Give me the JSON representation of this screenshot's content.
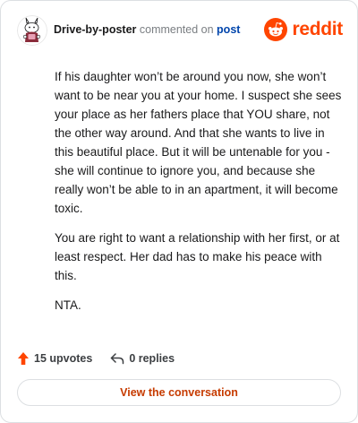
{
  "header": {
    "author": "Drive-by-poster",
    "action_text": "commented on",
    "target_link": "post",
    "brand_name": "reddit",
    "avatar_icon": "snoo-avatar-icon",
    "brand_icon": "reddit-snoo-icon"
  },
  "comment": {
    "paragraphs": [
      "If his daughter won’t be around you now, she won’t want to be near you at your home. I suspect she sees your place as her fathers place that YOU share, not the other way around. And that she wants to live in this beautiful place. But it will be untenable for you - she will continue to ignore you, and because she really won’t be able to in an apartment, it will become toxic.",
      "You are right to want a relationship with her first, or at least respect. Her dad has to make his peace with this.",
      "NTA."
    ]
  },
  "actions": {
    "upvotes": "15 upvotes",
    "replies": "0 replies",
    "upvote_icon": "upvote-arrow-icon",
    "reply_icon": "reply-arrow-icon"
  },
  "cta": {
    "label": "View the conversation"
  },
  "colors": {
    "brand": "#ff4500",
    "link": "#0045ac",
    "cta_text": "#c63b00",
    "border": "#dcdfe2"
  }
}
